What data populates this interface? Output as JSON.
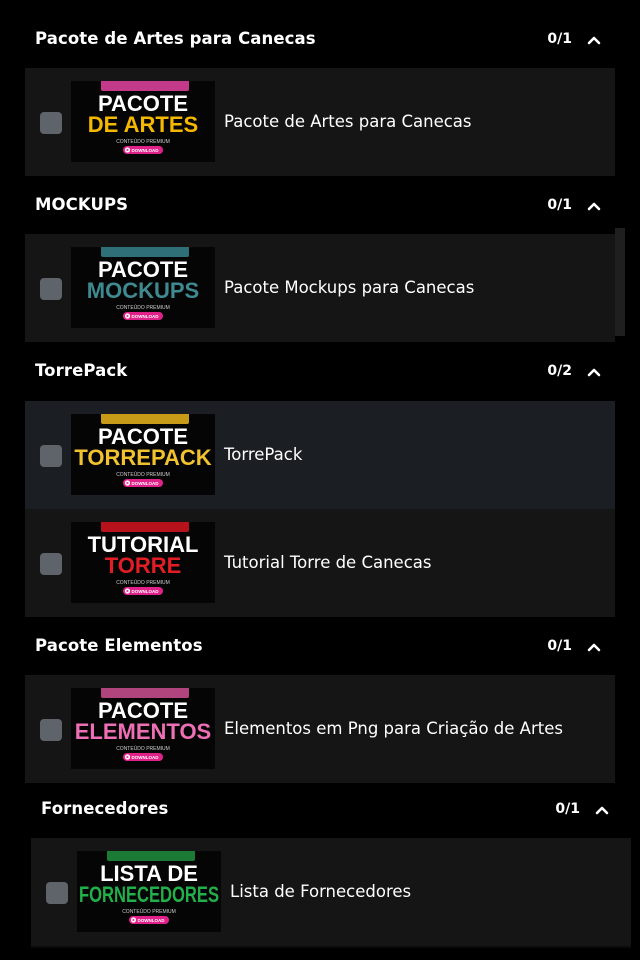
{
  "sections": [
    {
      "title": "Pacote de Artes para Canecas",
      "count": "0/1",
      "items": [
        {
          "label": "Pacote de Artes para Canecas",
          "thumb": {
            "line1": "PACOTE",
            "line2": "DE ARTES",
            "sub": "CONTEÚDO PREMIUM",
            "btn": "DOWNLOAD",
            "accent": "#f5b800",
            "box": "#c43a8a"
          }
        }
      ]
    },
    {
      "title": "MOCKUPS",
      "count": "0/1",
      "items": [
        {
          "label": "Pacote Mockups para Canecas",
          "thumb": {
            "line1": "PACOTE",
            "line2": "MOCKUPS",
            "sub": "CONTEÚDO PREMIUM",
            "btn": "DOWNLOAD",
            "accent": "#3e8a90",
            "box": "#2f6f77"
          }
        }
      ]
    },
    {
      "title": "TorrePack",
      "count": "0/2",
      "items": [
        {
          "label": "TorrePack",
          "thumb": {
            "line1": "PACOTE",
            "line2": "TORREPACK",
            "sub": "CONTEÚDO PREMIUM",
            "btn": "DOWNLOAD",
            "accent": "#f2c12e",
            "box": "#c79a18"
          }
        },
        {
          "label": "Tutorial Torre de Canecas",
          "thumb": {
            "line1": "TUTORIAL",
            "line2": "TORRE",
            "sub": "CONTEÚDO PREMIUM",
            "btn": "DOWNLOAD",
            "accent": "#e21d25",
            "box": "#b5121b"
          }
        }
      ]
    },
    {
      "title": "Pacote Elementos",
      "count": "0/1",
      "items": [
        {
          "label": "Elementos em Png para Criação de Artes",
          "thumb": {
            "line1": "PACOTE",
            "line2": "ELEMENTOS",
            "sub": "CONTEÚDO PREMIUM",
            "btn": "DOWNLOAD",
            "accent": "#ee6fb5",
            "box": "#b0447c"
          }
        }
      ]
    },
    {
      "title": "Fornecedores",
      "count": "0/1",
      "items": [
        {
          "label": "Lista de Fornecedores",
          "thumb": {
            "line1": "LISTA DE",
            "line2": "FORNECEDORES",
            "sub": "CONTEÚDO PREMIUM",
            "btn": "DOWNLOAD",
            "accent": "#22b04a",
            "box": "#1b7a35"
          }
        }
      ]
    }
  ],
  "colors": {
    "background": "#000000",
    "panel": "#151515",
    "checkbox": "#5f636a",
    "button": "#e0218a"
  },
  "icons": {
    "collapse": "chevron-up-icon",
    "play": "play-icon"
  }
}
